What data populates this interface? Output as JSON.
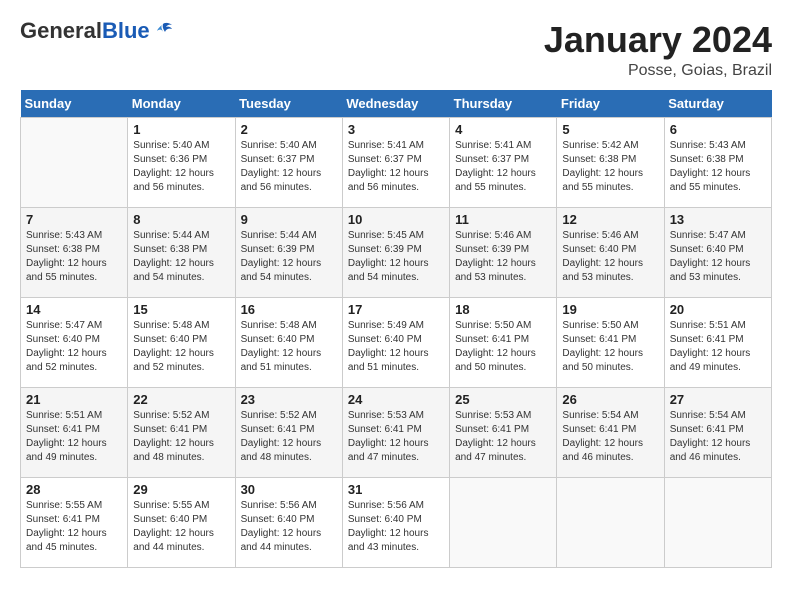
{
  "header": {
    "logo_general": "General",
    "logo_blue": "Blue",
    "month_title": "January 2024",
    "location": "Posse, Goias, Brazil"
  },
  "calendar": {
    "days_of_week": [
      "Sunday",
      "Monday",
      "Tuesday",
      "Wednesday",
      "Thursday",
      "Friday",
      "Saturday"
    ],
    "weeks": [
      [
        {
          "date": "",
          "sunrise": "",
          "sunset": "",
          "daylight": ""
        },
        {
          "date": "1",
          "sunrise": "Sunrise: 5:40 AM",
          "sunset": "Sunset: 6:36 PM",
          "daylight": "Daylight: 12 hours and 56 minutes."
        },
        {
          "date": "2",
          "sunrise": "Sunrise: 5:40 AM",
          "sunset": "Sunset: 6:37 PM",
          "daylight": "Daylight: 12 hours and 56 minutes."
        },
        {
          "date": "3",
          "sunrise": "Sunrise: 5:41 AM",
          "sunset": "Sunset: 6:37 PM",
          "daylight": "Daylight: 12 hours and 56 minutes."
        },
        {
          "date": "4",
          "sunrise": "Sunrise: 5:41 AM",
          "sunset": "Sunset: 6:37 PM",
          "daylight": "Daylight: 12 hours and 55 minutes."
        },
        {
          "date": "5",
          "sunrise": "Sunrise: 5:42 AM",
          "sunset": "Sunset: 6:38 PM",
          "daylight": "Daylight: 12 hours and 55 minutes."
        },
        {
          "date": "6",
          "sunrise": "Sunrise: 5:43 AM",
          "sunset": "Sunset: 6:38 PM",
          "daylight": "Daylight: 12 hours and 55 minutes."
        }
      ],
      [
        {
          "date": "7",
          "sunrise": "Sunrise: 5:43 AM",
          "sunset": "Sunset: 6:38 PM",
          "daylight": "Daylight: 12 hours and 55 minutes."
        },
        {
          "date": "8",
          "sunrise": "Sunrise: 5:44 AM",
          "sunset": "Sunset: 6:38 PM",
          "daylight": "Daylight: 12 hours and 54 minutes."
        },
        {
          "date": "9",
          "sunrise": "Sunrise: 5:44 AM",
          "sunset": "Sunset: 6:39 PM",
          "daylight": "Daylight: 12 hours and 54 minutes."
        },
        {
          "date": "10",
          "sunrise": "Sunrise: 5:45 AM",
          "sunset": "Sunset: 6:39 PM",
          "daylight": "Daylight: 12 hours and 54 minutes."
        },
        {
          "date": "11",
          "sunrise": "Sunrise: 5:46 AM",
          "sunset": "Sunset: 6:39 PM",
          "daylight": "Daylight: 12 hours and 53 minutes."
        },
        {
          "date": "12",
          "sunrise": "Sunrise: 5:46 AM",
          "sunset": "Sunset: 6:40 PM",
          "daylight": "Daylight: 12 hours and 53 minutes."
        },
        {
          "date": "13",
          "sunrise": "Sunrise: 5:47 AM",
          "sunset": "Sunset: 6:40 PM",
          "daylight": "Daylight: 12 hours and 53 minutes."
        }
      ],
      [
        {
          "date": "14",
          "sunrise": "Sunrise: 5:47 AM",
          "sunset": "Sunset: 6:40 PM",
          "daylight": "Daylight: 12 hours and 52 minutes."
        },
        {
          "date": "15",
          "sunrise": "Sunrise: 5:48 AM",
          "sunset": "Sunset: 6:40 PM",
          "daylight": "Daylight: 12 hours and 52 minutes."
        },
        {
          "date": "16",
          "sunrise": "Sunrise: 5:48 AM",
          "sunset": "Sunset: 6:40 PM",
          "daylight": "Daylight: 12 hours and 51 minutes."
        },
        {
          "date": "17",
          "sunrise": "Sunrise: 5:49 AM",
          "sunset": "Sunset: 6:40 PM",
          "daylight": "Daylight: 12 hours and 51 minutes."
        },
        {
          "date": "18",
          "sunrise": "Sunrise: 5:50 AM",
          "sunset": "Sunset: 6:41 PM",
          "daylight": "Daylight: 12 hours and 50 minutes."
        },
        {
          "date": "19",
          "sunrise": "Sunrise: 5:50 AM",
          "sunset": "Sunset: 6:41 PM",
          "daylight": "Daylight: 12 hours and 50 minutes."
        },
        {
          "date": "20",
          "sunrise": "Sunrise: 5:51 AM",
          "sunset": "Sunset: 6:41 PM",
          "daylight": "Daylight: 12 hours and 49 minutes."
        }
      ],
      [
        {
          "date": "21",
          "sunrise": "Sunrise: 5:51 AM",
          "sunset": "Sunset: 6:41 PM",
          "daylight": "Daylight: 12 hours and 49 minutes."
        },
        {
          "date": "22",
          "sunrise": "Sunrise: 5:52 AM",
          "sunset": "Sunset: 6:41 PM",
          "daylight": "Daylight: 12 hours and 48 minutes."
        },
        {
          "date": "23",
          "sunrise": "Sunrise: 5:52 AM",
          "sunset": "Sunset: 6:41 PM",
          "daylight": "Daylight: 12 hours and 48 minutes."
        },
        {
          "date": "24",
          "sunrise": "Sunrise: 5:53 AM",
          "sunset": "Sunset: 6:41 PM",
          "daylight": "Daylight: 12 hours and 47 minutes."
        },
        {
          "date": "25",
          "sunrise": "Sunrise: 5:53 AM",
          "sunset": "Sunset: 6:41 PM",
          "daylight": "Daylight: 12 hours and 47 minutes."
        },
        {
          "date": "26",
          "sunrise": "Sunrise: 5:54 AM",
          "sunset": "Sunset: 6:41 PM",
          "daylight": "Daylight: 12 hours and 46 minutes."
        },
        {
          "date": "27",
          "sunrise": "Sunrise: 5:54 AM",
          "sunset": "Sunset: 6:41 PM",
          "daylight": "Daylight: 12 hours and 46 minutes."
        }
      ],
      [
        {
          "date": "28",
          "sunrise": "Sunrise: 5:55 AM",
          "sunset": "Sunset: 6:41 PM",
          "daylight": "Daylight: 12 hours and 45 minutes."
        },
        {
          "date": "29",
          "sunrise": "Sunrise: 5:55 AM",
          "sunset": "Sunset: 6:40 PM",
          "daylight": "Daylight: 12 hours and 44 minutes."
        },
        {
          "date": "30",
          "sunrise": "Sunrise: 5:56 AM",
          "sunset": "Sunset: 6:40 PM",
          "daylight": "Daylight: 12 hours and 44 minutes."
        },
        {
          "date": "31",
          "sunrise": "Sunrise: 5:56 AM",
          "sunset": "Sunset: 6:40 PM",
          "daylight": "Daylight: 12 hours and 43 minutes."
        },
        {
          "date": "",
          "sunrise": "",
          "sunset": "",
          "daylight": ""
        },
        {
          "date": "",
          "sunrise": "",
          "sunset": "",
          "daylight": ""
        },
        {
          "date": "",
          "sunrise": "",
          "sunset": "",
          "daylight": ""
        }
      ]
    ]
  }
}
